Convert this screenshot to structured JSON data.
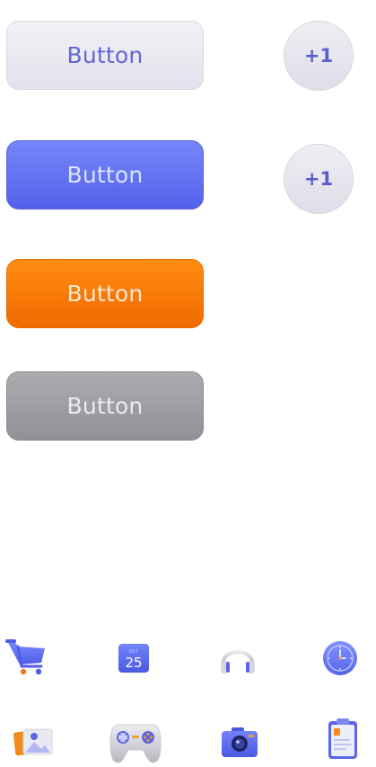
{
  "buttons": [
    {
      "label": "Button",
      "style": "light"
    },
    {
      "label": "Button",
      "style": "blue"
    },
    {
      "label": "Button",
      "style": "orange"
    },
    {
      "label": "Button",
      "style": "gray"
    }
  ],
  "counters": [
    {
      "label": "+1"
    },
    {
      "label": "+1"
    }
  ],
  "icons": {
    "row1": [
      "cart-icon",
      "calendar-icon",
      "headphones-icon",
      "clock-icon"
    ],
    "row2": [
      "photos-icon",
      "gamepad-icon",
      "camera-icon",
      "clipboard-icon"
    ]
  },
  "calendar": {
    "month": "OCT",
    "day": "25"
  },
  "colors": {
    "accent_blue": "#5a63e8",
    "accent_orange": "#f57a00",
    "gray": "#9e9ea3",
    "light": "#e8e7ef",
    "light_text": "#6366d6"
  }
}
